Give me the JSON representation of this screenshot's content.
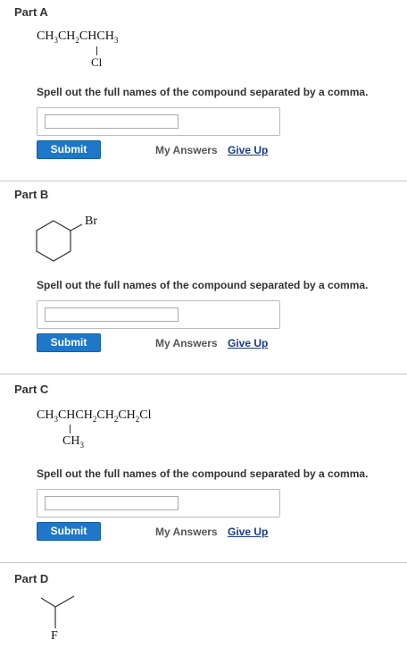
{
  "parts": [
    {
      "title": "Part A",
      "formula_main": [
        "CH",
        "3",
        "CH",
        "2",
        "CHCH",
        "3"
      ],
      "formula_sub": "Cl",
      "prompt": "Spell out the full names of the compound separated by a comma.",
      "answer_value": "",
      "submit_label": "Submit",
      "my_answers_label": "My Answers",
      "give_up_label": "Give Up"
    },
    {
      "title": "Part B",
      "structure_label": "Br",
      "prompt": "Spell out the full names of the compound separated by a comma.",
      "answer_value": "",
      "submit_label": "Submit",
      "my_answers_label": "My Answers",
      "give_up_label": "Give Up"
    },
    {
      "title": "Part C",
      "formula_main": [
        "CH",
        "3",
        "CHCH",
        "2",
        "CH",
        "2",
        "CH",
        "2",
        "Cl"
      ],
      "formula_sub": [
        "CH",
        "3"
      ],
      "prompt": "Spell out the full names of the compound separated by a comma.",
      "answer_value": "",
      "submit_label": "Submit",
      "my_answers_label": "My Answers",
      "give_up_label": "Give Up"
    },
    {
      "title": "Part D",
      "structure_label": "F"
    }
  ]
}
